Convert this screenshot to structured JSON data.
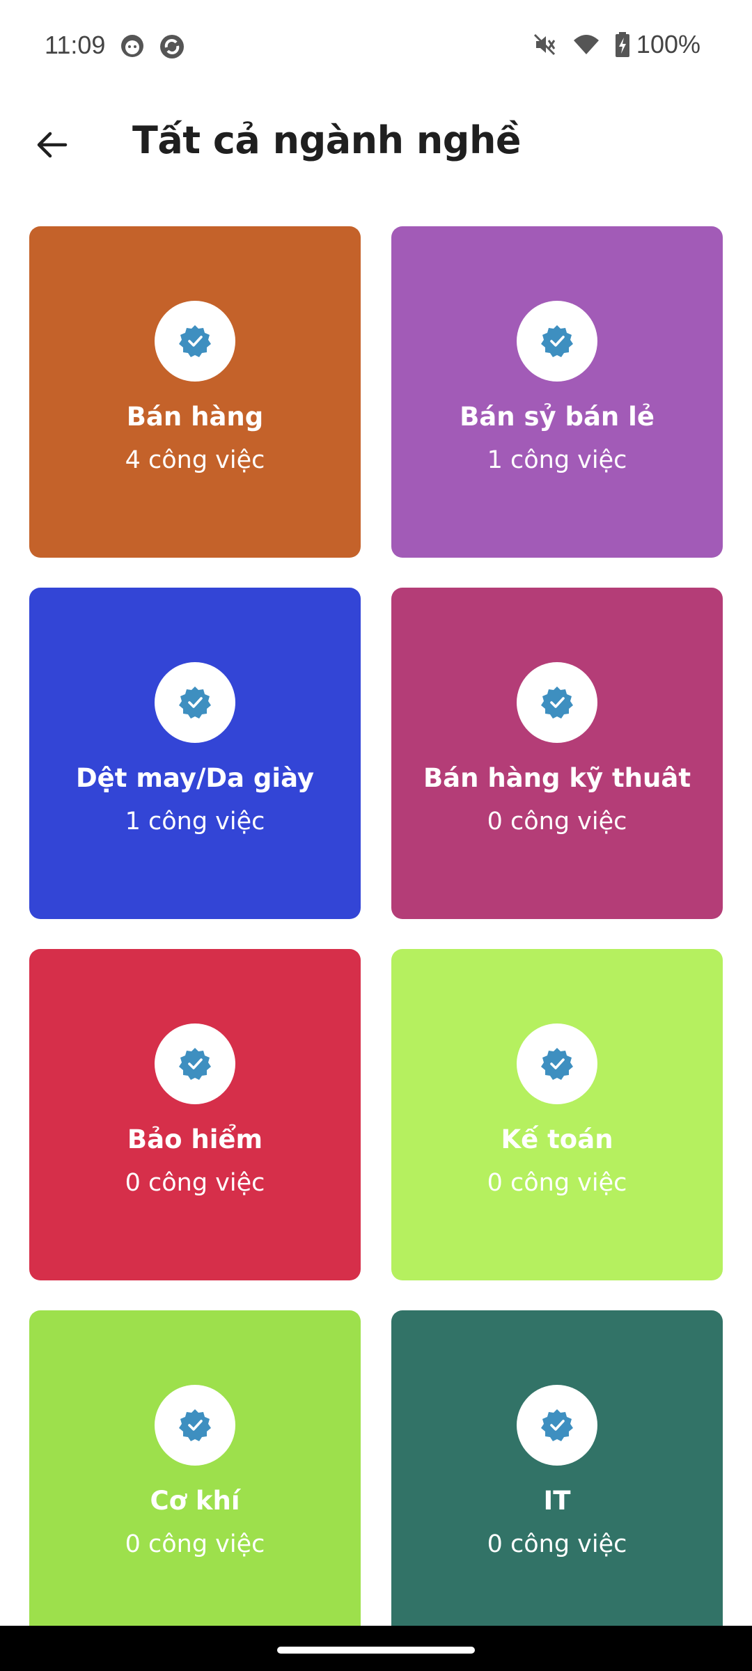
{
  "status_bar": {
    "time": "11:09",
    "battery": "100%",
    "icons": [
      "app-face-icon",
      "app-sync-icon",
      "mute-icon",
      "wifi-icon",
      "battery-charging-icon"
    ]
  },
  "header": {
    "title": "Tất cả ngành nghề",
    "back_icon": "arrow-left-icon"
  },
  "colors": {
    "badge_check": "#3e8fc0"
  },
  "categories": [
    {
      "name": "Bán hàng",
      "count": "4 công việc",
      "color": "#c4622a"
    },
    {
      "name": "Bán sỷ bán lẻ",
      "count": "1 công việc",
      "color": "#a25bb7"
    },
    {
      "name": "Dệt may/Da giày",
      "count": "1 công việc",
      "color": "#3345d6"
    },
    {
      "name": "Bán hàng kỹ thuât",
      "count": "0 công việc",
      "color": "#b43d77"
    },
    {
      "name": "Bảo hiểm",
      "count": "0 công việc",
      "color": "#d62f4a"
    },
    {
      "name": "Kế toán",
      "count": "0 công việc",
      "color": "#b5f05f"
    },
    {
      "name": "Cơ khí",
      "count": "0 công việc",
      "color": "#9de04c"
    },
    {
      "name": "IT",
      "count": "0 công việc",
      "color": "#327367"
    }
  ]
}
